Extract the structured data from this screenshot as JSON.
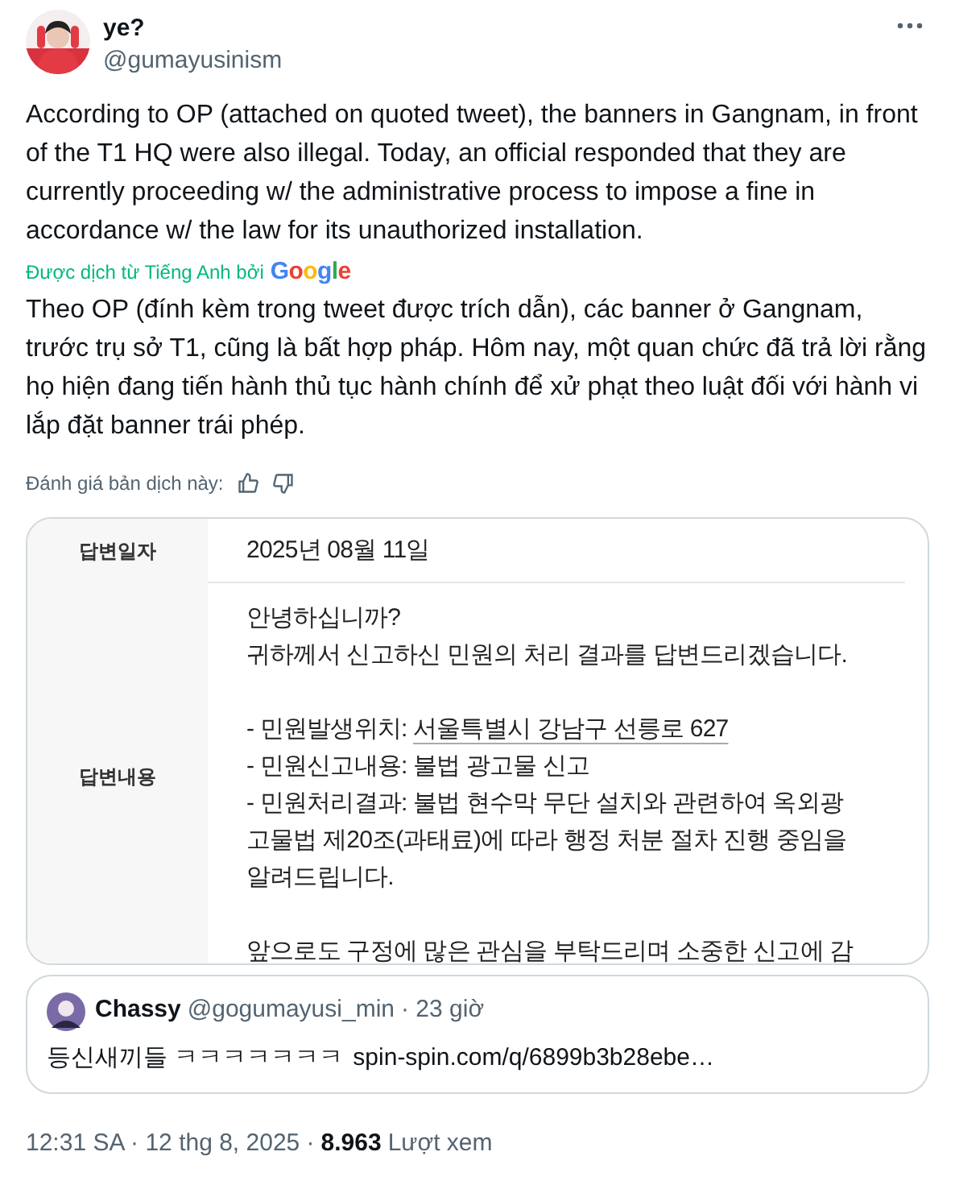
{
  "author": {
    "name": "ye?",
    "handle": "@gumayusinism"
  },
  "tweet_text": "According to OP (attached on quoted tweet), the banners in Gangnam, in front of the T1 HQ were also illegal. Today, an official responded that they are currently proceeding w/ the administrative process to impose a fine in accordance w/ the law for its unauthorized installation.",
  "translation": {
    "label": "Được dịch từ Tiếng Anh bởi",
    "provider": "Google",
    "text": "Theo OP (đính kèm trong tweet được trích dẫn), các banner ở Gangnam, trước trụ sở T1, cũng là bất hợp pháp. Hôm nay, một quan chức đã trả lời rằng họ hiện đang tiến hành thủ tục hành chính để xử phạt theo luật đối với hành vi lắp đặt banner trái phép."
  },
  "rate_translation": {
    "label": "Đánh giá bản dịch này:"
  },
  "attached_image": {
    "rows": [
      {
        "label": "답변일자",
        "paragraphs": [
          [
            {
              "text": "2025년 08월 11일"
            }
          ]
        ]
      },
      {
        "label": "답변내용",
        "paragraphs": [
          [
            {
              "text": "안녕하십니까?"
            },
            {
              "text": "귀하께서 신고하신 민원의 처리 결과를 답변드리겠습니다."
            }
          ],
          [
            {
              "text": "- 민원발생위치: ",
              "link": "서울특별시 강남구 선릉로 627"
            },
            {
              "text": "- 민원신고내용: 불법 광고물 신고"
            },
            {
              "text": "- 민원처리결과: 불법 현수막 무단 설치와 관련하여 옥외광"
            },
            {
              "text": "고물법 제20조(과태료)에 따라 행정 처분 절차 진행 중임을"
            },
            {
              "text": "알려드립니다."
            }
          ],
          [
            {
              "text": "앞으로도 구정에 많은 관심을 부탁드리며 소중한 신고에 감"
            }
          ]
        ]
      }
    ]
  },
  "quoted_tweet": {
    "name": "Chassy",
    "handle": "@gogumayusi_min",
    "time": "· 23 giờ",
    "text": "등신새끼들 ㅋㅋㅋㅋㅋㅋㅋ",
    "link": "spin-spin.com/q/6899b3b28ebe…"
  },
  "footer": {
    "time": "12:31 SA · 12 thg 8, 2025 ·",
    "views": "8.963",
    "views_label": "Lượt xem"
  }
}
